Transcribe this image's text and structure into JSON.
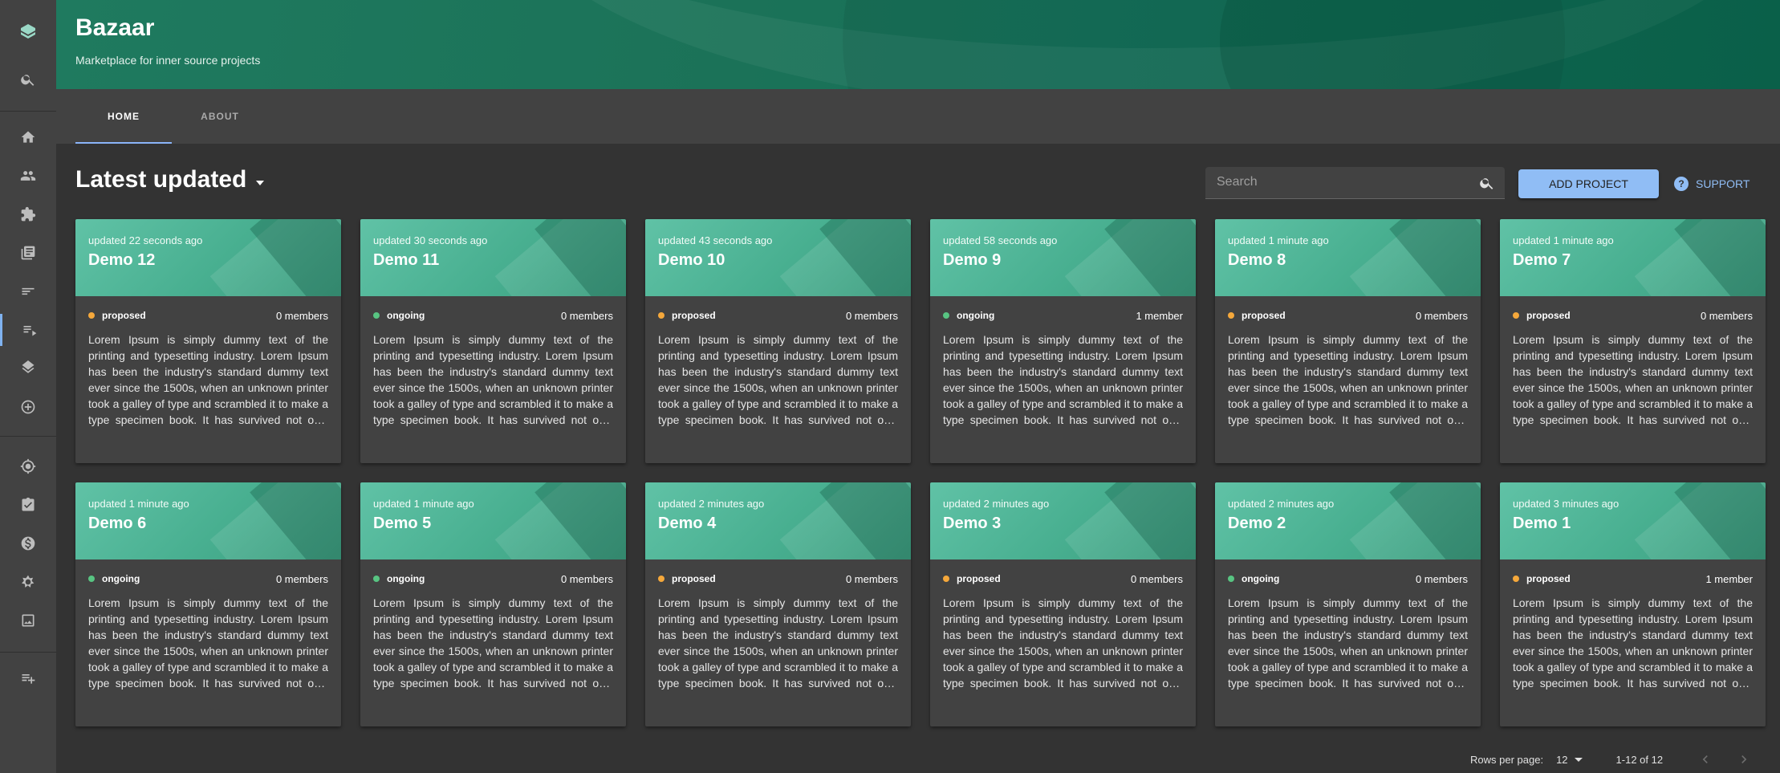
{
  "app": {
    "title": "Bazaar",
    "subtitle": "Marketplace for inner source projects"
  },
  "sidebar": {
    "items": [
      {
        "icon": "backstage-logo-icon"
      },
      {
        "icon": "search-icon"
      },
      {
        "icon": "home-icon"
      },
      {
        "icon": "groups-icon"
      },
      {
        "icon": "extension-icon"
      },
      {
        "icon": "library-books-icon"
      },
      {
        "icon": "list-icon"
      },
      {
        "icon": "playlist-icon"
      },
      {
        "icon": "layers-icon"
      },
      {
        "icon": "add-circle-icon"
      },
      {
        "icon": "radar-icon"
      },
      {
        "icon": "assignment-icon"
      },
      {
        "icon": "money-icon"
      },
      {
        "icon": "settings-star-icon"
      },
      {
        "icon": "image-icon"
      },
      {
        "icon": "playlist-add-icon"
      }
    ]
  },
  "tabs": [
    {
      "label": "HOME",
      "active": true
    },
    {
      "label": "ABOUT",
      "active": false
    }
  ],
  "toolbar": {
    "section_title": "Latest updated",
    "search_placeholder": "Search",
    "add_project_label": "ADD PROJECT",
    "support_label": "SUPPORT"
  },
  "colors": {
    "proposed": "#f5a83b",
    "ongoing": "#58c482",
    "accent": "#90bdf5",
    "header": "#1b7258"
  },
  "projects": [
    {
      "updated": "updated 22 seconds ago",
      "name": "Demo 12",
      "status": "proposed",
      "members": "0 members"
    },
    {
      "updated": "updated 30 seconds ago",
      "name": "Demo 11",
      "status": "ongoing",
      "members": "0 members"
    },
    {
      "updated": "updated 43 seconds ago",
      "name": "Demo 10",
      "status": "proposed",
      "members": "0 members"
    },
    {
      "updated": "updated 58 seconds ago",
      "name": "Demo 9",
      "status": "ongoing",
      "members": "1 member"
    },
    {
      "updated": "updated 1 minute ago",
      "name": "Demo 8",
      "status": "proposed",
      "members": "0 members"
    },
    {
      "updated": "updated 1 minute ago",
      "name": "Demo 7",
      "status": "proposed",
      "members": "0 members"
    },
    {
      "updated": "updated 1 minute ago",
      "name": "Demo 6",
      "status": "ongoing",
      "members": "0 members"
    },
    {
      "updated": "updated 1 minute ago",
      "name": "Demo 5",
      "status": "ongoing",
      "members": "0 members"
    },
    {
      "updated": "updated 2 minutes ago",
      "name": "Demo 4",
      "status": "proposed",
      "members": "0 members"
    },
    {
      "updated": "updated 2 minutes ago",
      "name": "Demo 3",
      "status": "proposed",
      "members": "0 members"
    },
    {
      "updated": "updated 2 minutes ago",
      "name": "Demo 2",
      "status": "ongoing",
      "members": "0 members"
    },
    {
      "updated": "updated 3 minutes ago",
      "name": "Demo 1",
      "status": "proposed",
      "members": "1 member"
    }
  ],
  "description": "Lorem Ipsum is simply dummy text of the printing and typesetting industry. Lorem Ipsum has been the industry's standard dummy text ever since the 1500s, when an unknown printer took a galley of type and scrambled it to make a type specimen book. It has survived not only five centuries, but also the leap into electronic typesetting, remaining essentially unchanged.",
  "pagination": {
    "rows_per_page_label": "Rows per page:",
    "rows_per_page": "12",
    "range": "1-12 of 12"
  }
}
